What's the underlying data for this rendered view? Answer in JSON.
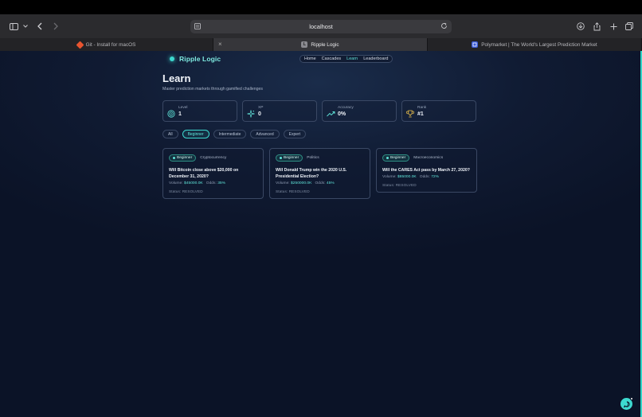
{
  "browser": {
    "url": "localhost",
    "tabs": [
      {
        "title": "Git - Install for macOS",
        "favicon": "git-icon"
      },
      {
        "title": "Ripple Logic",
        "favicon": "L",
        "active": true
      },
      {
        "title": "Polymarket | The World's Largest Prediction Market",
        "favicon": "polymarket-icon"
      }
    ]
  },
  "app": {
    "brand": "Ripple Logic",
    "nav": {
      "home": "Home",
      "cascades": "Cascades",
      "learn": "Learn",
      "leaderboard": "Leaderboard",
      "active": "Learn"
    },
    "title": "Learn",
    "subtitle": "Master prediction markets through gamified challenges",
    "stats": [
      {
        "label": "Level",
        "value": "1",
        "icon": "level-icon"
      },
      {
        "label": "XP",
        "value": "0",
        "icon": "sparkle-icon"
      },
      {
        "label": "Accuracy",
        "value": "0%",
        "icon": "trend-up-icon"
      },
      {
        "label": "Rank",
        "value": "#1",
        "icon": "trophy-icon"
      }
    ],
    "filters": [
      "All",
      "Beginner",
      "Intermediate",
      "Advanced",
      "Expert"
    ],
    "active_filter": "Beginner",
    "cards": [
      {
        "level": "Beginner",
        "category": "Cryptocurrency",
        "question": "Will Bitcoin close above $20,000 on December 31, 2020?",
        "volume_label": "Volume:",
        "volume": "$45000.0K",
        "odds_label": "Odds:",
        "odds": "35%",
        "status": "Status: RESOLVED"
      },
      {
        "level": "Beginner",
        "category": "Politics",
        "question": "Will Donald Trump win the 2020 U.S. Presidential Election?",
        "volume_label": "Volume:",
        "volume": "$250000.0K",
        "odds_label": "Odds:",
        "odds": "45%",
        "status": "Status: RESOLVED"
      },
      {
        "level": "Beginner",
        "category": "Macroeconomics",
        "question": "Will the CARES Act pass by March 27, 2020?",
        "volume_label": "Volume:",
        "volume": "$85000.0K",
        "odds_label": "Odds:",
        "odds": "72%",
        "status": "Status: RESOLVED"
      }
    ]
  },
  "colors": {
    "accent": "#3dd9cf",
    "background": "#0c1428",
    "card_border": "#3a4864"
  }
}
